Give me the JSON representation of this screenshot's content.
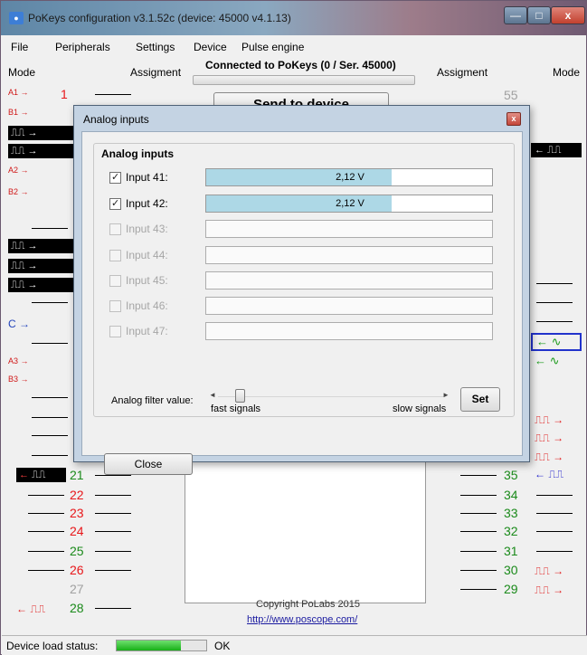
{
  "window": {
    "title": "PoKeys configuration v3.1.52c (device: 45000 v4.1.13)",
    "minimize_glyph": "—",
    "maximize_glyph": "□",
    "close_glyph": "x"
  },
  "menu": [
    "File",
    "Peripherals",
    "Settings",
    "Device",
    "Pulse engine"
  ],
  "header": {
    "mode_left": "Mode",
    "assigment_left": "Assigment",
    "connected": "Connected to PoKeys (0 / Ser. 45000)",
    "assigment_right": "Assigment",
    "mode_right": "Mode",
    "send_button": "Send to device"
  },
  "left_pins": {
    "row1_label": "A1 →",
    "row1_num": "1",
    "row2_label": "B1 →",
    "row5_label": "A2 →",
    "row6_label": "B2 →",
    "row11_label": "C →",
    "row13_label": "A3 →",
    "row14_label": "B3 →",
    "pin21": "21",
    "pin22": "22",
    "pin23": "23",
    "pin24": "24",
    "pin25": "25",
    "pin26": "26",
    "pin27": "27",
    "pin28": "28"
  },
  "right_pins": {
    "pin55": "55",
    "pin35": "35",
    "pin34": "34",
    "pin33": "33",
    "pin32": "32",
    "pin31": "31",
    "pin30": "30",
    "pin29": "29"
  },
  "footer": {
    "copyright": "Copyright PoLabs 2015",
    "link": "http://www.poscope.com/",
    "status_label": "Device load status:",
    "status_value": "OK",
    "status_progress": 0.72
  },
  "dialog": {
    "title": "Analog inputs",
    "close_glyph": "x",
    "group_title": "Analog inputs",
    "inputs": [
      {
        "label": "Input 41:",
        "checked": true,
        "enabled": true,
        "value_text": "2,12 V",
        "fill": 0.65
      },
      {
        "label": "Input 42:",
        "checked": true,
        "enabled": true,
        "value_text": "2,12 V",
        "fill": 0.65
      },
      {
        "label": "Input 43:",
        "checked": false,
        "enabled": false,
        "value_text": "",
        "fill": 0
      },
      {
        "label": "Input 44:",
        "checked": false,
        "enabled": false,
        "value_text": "",
        "fill": 0
      },
      {
        "label": "Input 45:",
        "checked": false,
        "enabled": false,
        "value_text": "",
        "fill": 0
      },
      {
        "label": "Input 46:",
        "checked": false,
        "enabled": false,
        "value_text": "",
        "fill": 0
      },
      {
        "label": "Input 47:",
        "checked": false,
        "enabled": false,
        "value_text": "",
        "fill": 0
      }
    ],
    "filter_label": "Analog filter value:",
    "slider_left": "◄",
    "slider_right": "►",
    "slider_value": 0.07,
    "fast_label": "fast signals",
    "slow_label": "slow signals",
    "set_button": "Set",
    "close_button": "Close"
  }
}
